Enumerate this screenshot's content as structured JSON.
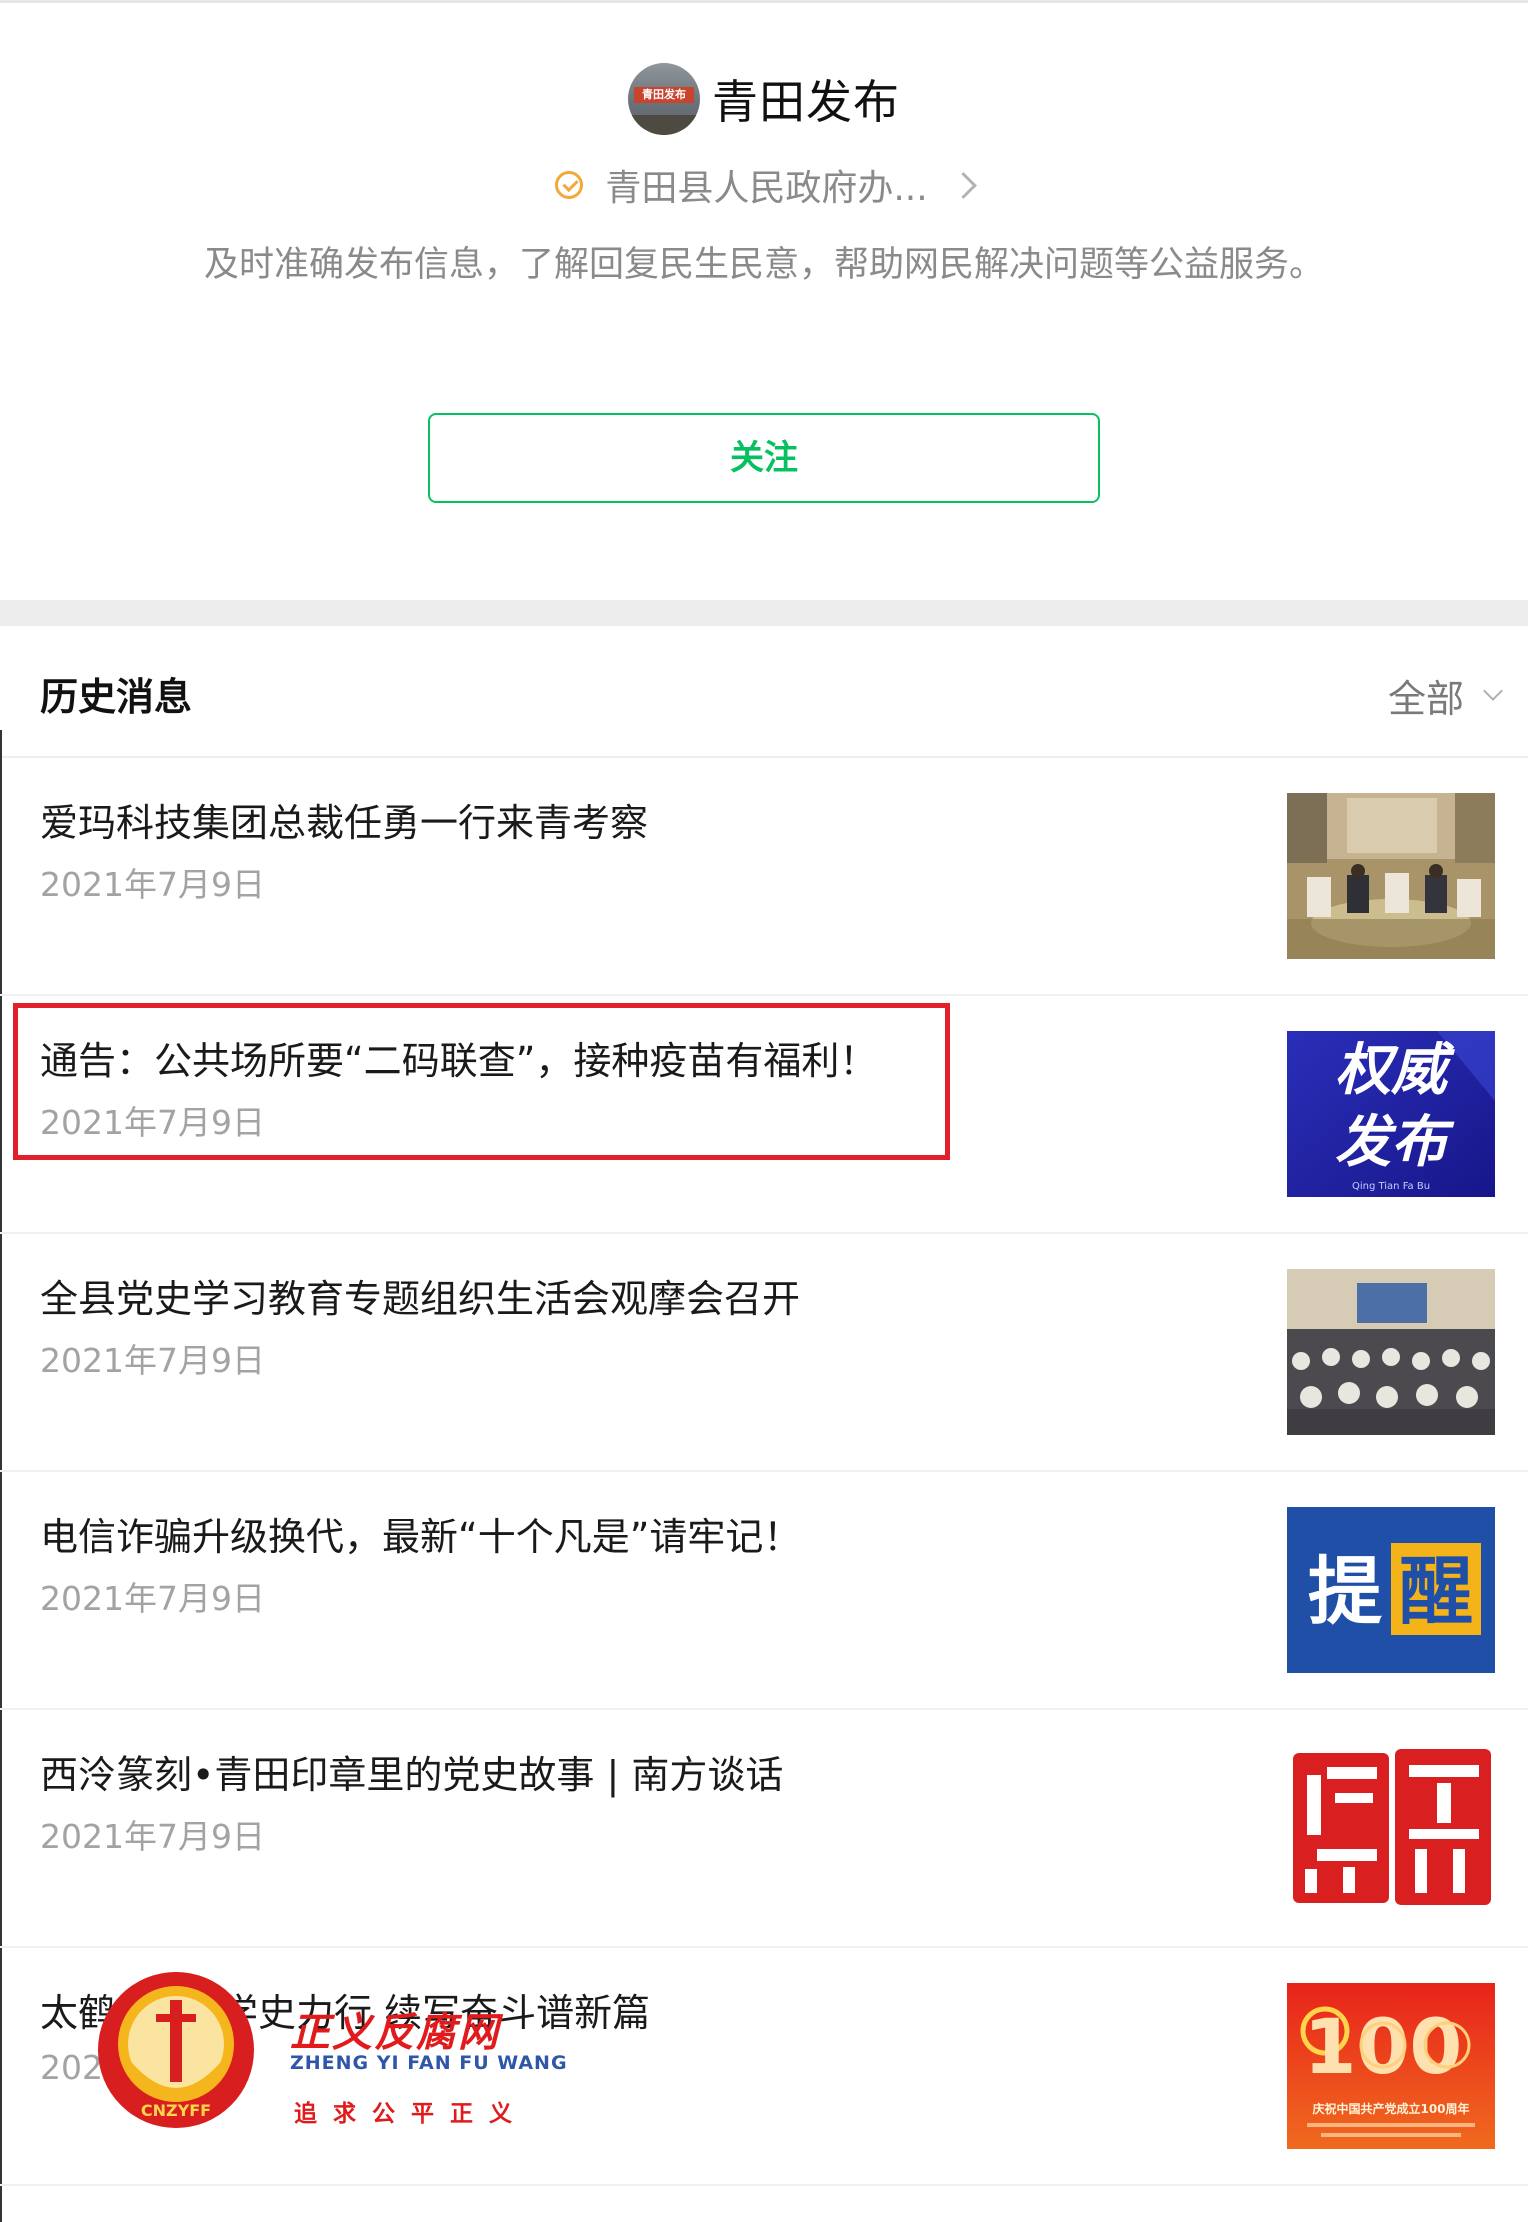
{
  "account": {
    "name": "青田发布",
    "avatar_tag": "青田发布",
    "organization": "青田县人民政府办...",
    "description": "及时准确发布信息，了解回复民生民意，帮助网民解决问题等公益服务。",
    "follow_label": "关注"
  },
  "history": {
    "title": "历史消息",
    "filter_label": "全部",
    "articles": [
      {
        "title": "爱玛科技集团总裁任勇一行来青考察",
        "date": "2021年7月9日",
        "thumb": "meeting-photo"
      },
      {
        "title": "通告：公共场所要“二码联查”，接种疫苗有福利！",
        "date": "2021年7月9日",
        "thumb": "authority-release-banner",
        "thumb_text_1": "权威",
        "thumb_text_2": "发布",
        "thumb_sub": "Qing Tian Fa Bu"
      },
      {
        "title": "全县党史学习教育专题组织生活会观摩会召开",
        "date": "2021年7月9日",
        "thumb": "conference-hall-photo"
      },
      {
        "title": "电信诈骗升级换代，最新“十个凡是”请牢记！",
        "date": "2021年7月9日",
        "thumb": "reminder-banner",
        "thumb_text_1": "提",
        "thumb_text_2": "醒"
      },
      {
        "title": "西泠篆刻•青田印章里的党史故事 | 南方谈话",
        "date": "2021年7月9日",
        "thumb": "seal-stamp-image"
      },
      {
        "title": "太鹤",
        "title_tail": "学史力行 续写奋斗谱新篇",
        "date": "202",
        "thumb": "party-centenary-banner",
        "thumb_caption": "庆祝中国共产党成立100周年"
      }
    ]
  },
  "watermark": {
    "title": "正义反腐网",
    "pinyin": "ZHENG YI FAN FU WANG",
    "motto": "追求公平正义",
    "emblem_text": "CNZYFF"
  },
  "colors": {
    "accent_green": "#07c160",
    "highlight_red": "#e0202a",
    "verified_orange": "#f3a93a"
  }
}
